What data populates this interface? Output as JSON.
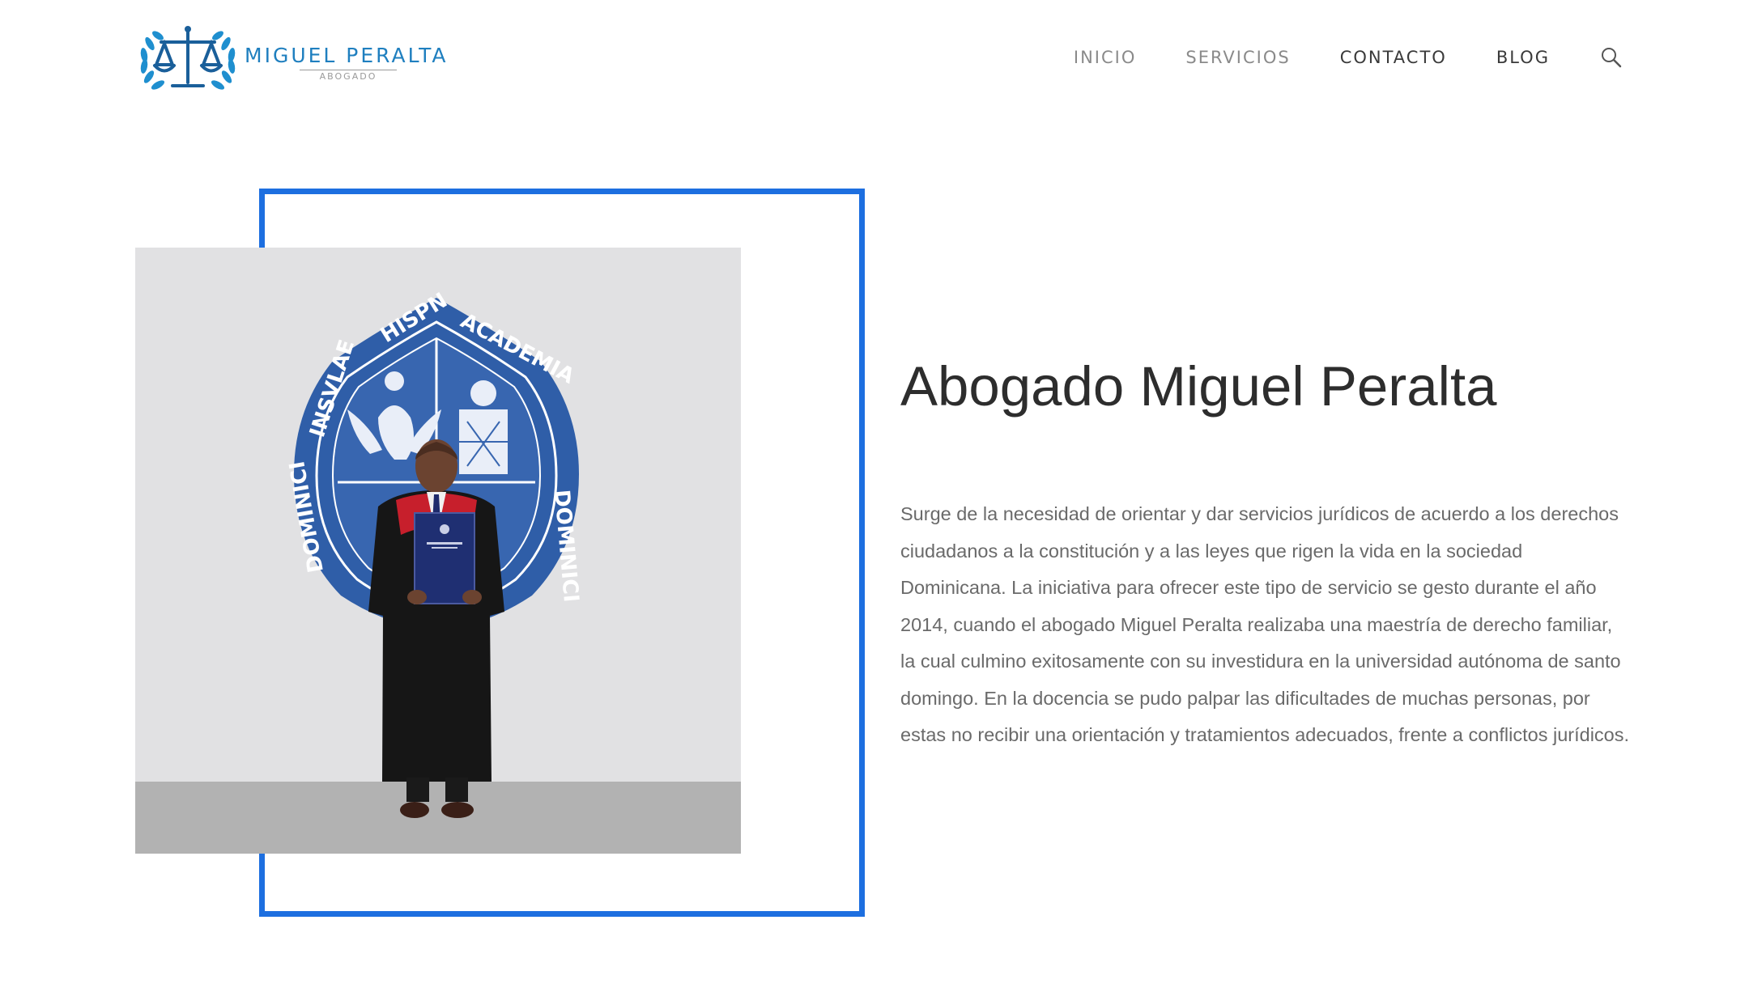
{
  "brand": {
    "name": "MIGUEL PERALTA",
    "subtitle": "ABOGADO",
    "logo_icon": "scales-of-justice-laurel-icon",
    "color": "#1f7fbf"
  },
  "nav": {
    "items": [
      {
        "label": "INICIO"
      },
      {
        "label": "SERVICIOS"
      },
      {
        "label": "CONTACTO"
      },
      {
        "label": "BLOG"
      }
    ],
    "search_icon": "search-icon"
  },
  "hero": {
    "frame_color": "#1d6fe0",
    "photo": "graduate-in-gown-holding-diploma-in-front-of-university-seal",
    "seal_text": "ACADEMIA HISPN INSVLAE DOMINICI"
  },
  "content": {
    "title": "Abogado Miguel Peralta",
    "body": "Surge de la necesidad de orientar y dar servicios jurídicos de acuerdo a los derechos ciudadanos a la constitución y a las leyes que rigen la vida en la sociedad Dominicana. La iniciativa para ofrecer este tipo de servicio se gesto durante el año 2014, cuando el abogado Miguel Peralta realizaba una maestría de derecho familiar, la cual culmino exitosamente con su investidura en la universidad autónoma de santo domingo. En la docencia se pudo palpar las dificultades de muchas personas, por estas no recibir una orientación y tratamientos adecuados, frente a conflictos jurídicos."
  }
}
